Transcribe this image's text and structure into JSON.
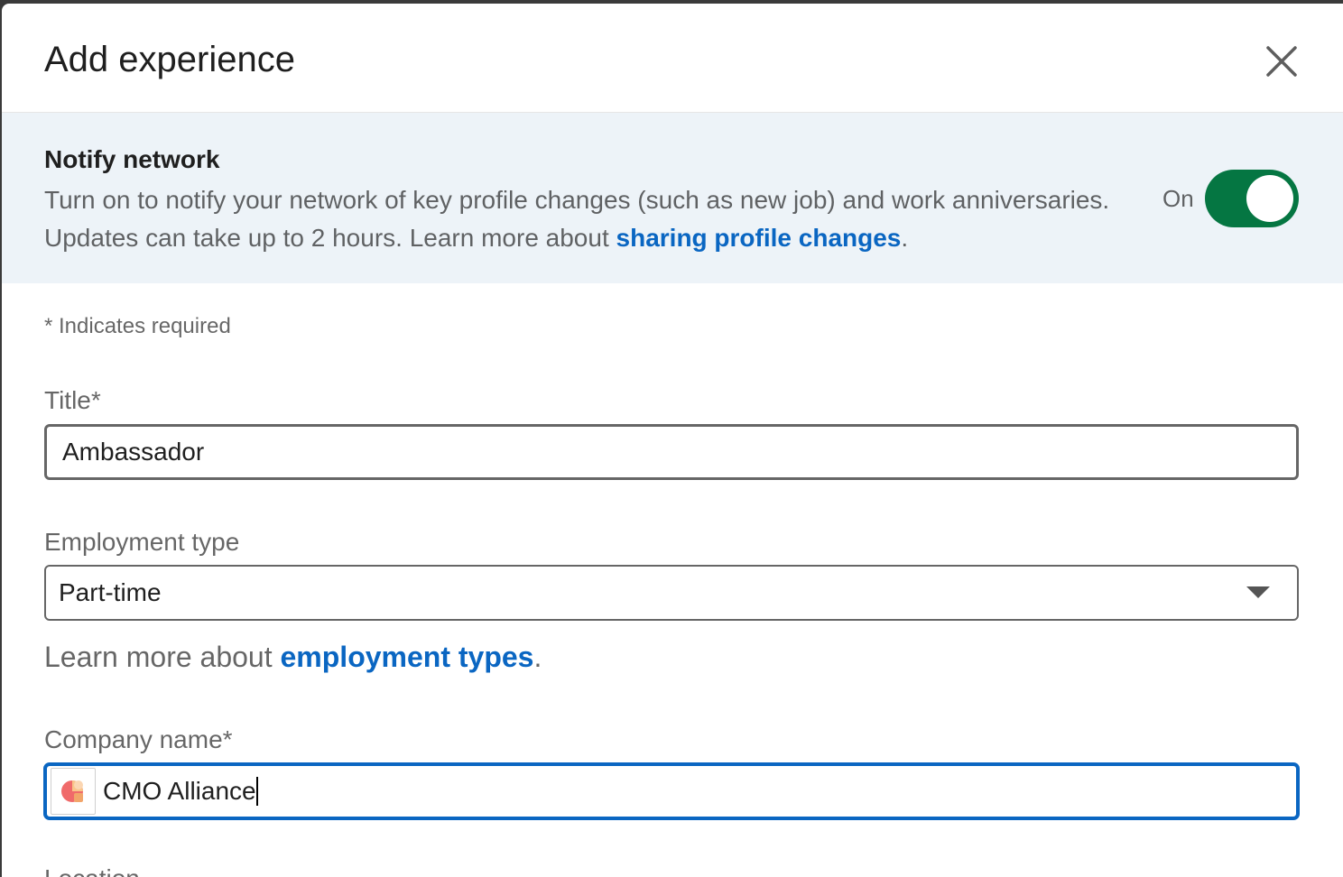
{
  "header": {
    "title": "Add experience",
    "close_icon": "close-icon"
  },
  "notify": {
    "title": "Notify network",
    "description": "Turn on to notify your network of key profile changes (such as new job) and work anniversaries. Updates can take up to 2 hours. Learn more about ",
    "link_text": "sharing profile changes",
    "period": ".",
    "toggle_label": "On",
    "toggle_on": true,
    "toggle_color": "#057642"
  },
  "form": {
    "required_note": "* Indicates required",
    "title_label": "Title*",
    "title_value": "Ambassador",
    "employment_label": "Employment type",
    "employment_value": "Part-time",
    "learn_prefix": "Learn more about ",
    "learn_link": "employment types",
    "learn_period": ".",
    "company_label": "Company name*",
    "company_value": "CMO Alliance",
    "company_logo_icon": "company-logo-icon",
    "location_label": "Location"
  },
  "colors": {
    "link": "#0a66c2",
    "focus_border": "#0a66c2",
    "notify_bg": "#edf3f8"
  }
}
